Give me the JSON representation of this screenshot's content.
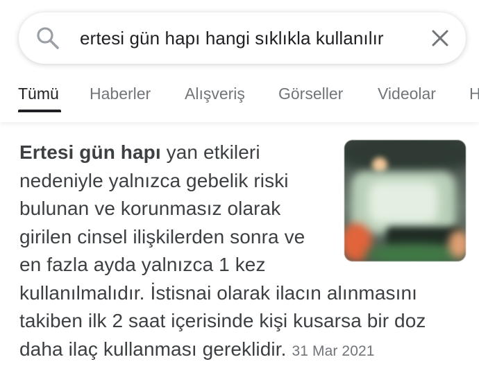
{
  "search": {
    "query": "ertesi gün hapı hangi sıklıkla kullanılır"
  },
  "tabs": [
    {
      "label": "Tümü",
      "active": true
    },
    {
      "label": "Haberler",
      "active": false
    },
    {
      "label": "Alışveriş",
      "active": false
    },
    {
      "label": "Görseller",
      "active": false
    },
    {
      "label": "Videolar",
      "active": false
    },
    {
      "label": "H",
      "active": false
    }
  ],
  "result": {
    "bold_lead": "Ertesi gün hapı",
    "lines": [
      " yan etkileri",
      "nedeniyle yalnızca gebelik riski",
      "bulunan ve korunmasız olarak",
      "girilen cinsel ilişkilerden sonra ve",
      "en fazla ayda yalnızca 1 kez",
      "kullanılmalıdır. İstisnai olarak ilacın alınmasını",
      "takiben ilk 2 saat içerisinde kişi kusarsa bir doz",
      "daha ilaç kullanması gereklidir."
    ],
    "date": "31 Mar 2021"
  },
  "colors": {
    "text_primary": "#202124",
    "text_snippet": "#3c4043",
    "text_secondary": "#70757a"
  }
}
